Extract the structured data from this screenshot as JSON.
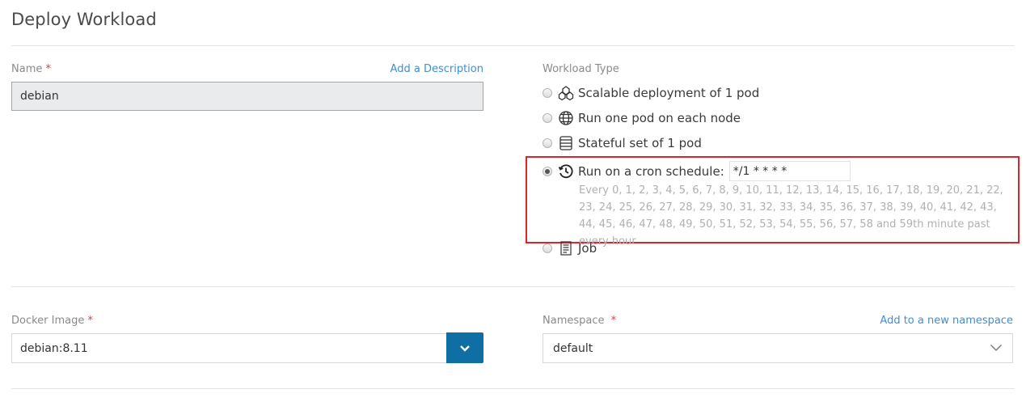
{
  "page": {
    "title": "Deploy Workload"
  },
  "name_field": {
    "label": "Name",
    "required_mark": "*",
    "value": "debian",
    "add_description": "Add a Description"
  },
  "workload_type": {
    "label": "Workload Type",
    "options": [
      {
        "label": "Scalable deployment of 1 pod",
        "icon": "cluster-icon",
        "selected": false
      },
      {
        "label": "Run one pod on each node",
        "icon": "globe-icon",
        "selected": false
      },
      {
        "label": "Stateful set of 1 pod",
        "icon": "database-icon",
        "selected": false
      },
      {
        "label": "Run on a cron schedule:",
        "icon": "clock-history-icon",
        "selected": true
      },
      {
        "label": "Job",
        "icon": "document-icon",
        "selected": false
      }
    ],
    "cron_value": "*/1 * * * *",
    "cron_description": "Every 0, 1, 2, 3, 4, 5, 6, 7, 8, 9, 10, 11, 12, 13, 14, 15, 16, 17, 18, 19, 20, 21, 22, 23, 24, 25, 26, 27, 28, 29, 30, 31, 32, 33, 34, 35, 36, 37, 38, 39, 40, 41, 42, 43, 44, 45, 46, 47, 48, 49, 50, 51, 52, 53, 54, 55, 56, 57, 58 and 59th minute past every hour"
  },
  "docker_image": {
    "label": "Docker Image",
    "required_mark": "*",
    "value": "debian:8.11"
  },
  "namespace": {
    "label": "Namespace",
    "required_mark": "*",
    "value": "default",
    "add_link": "Add to a new namespace"
  },
  "colors": {
    "link": "#3d8fd6",
    "required": "#e03a3a",
    "highlight": "#d9252b",
    "button": "#0f6ea3"
  }
}
